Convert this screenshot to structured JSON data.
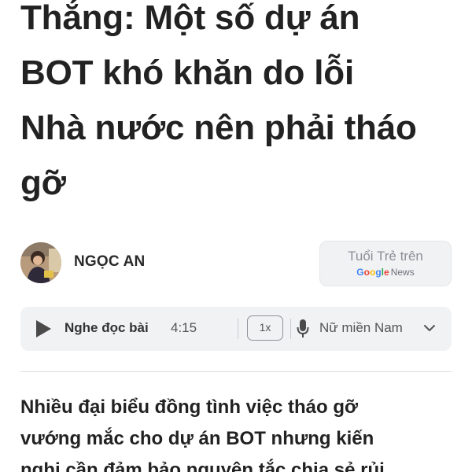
{
  "article": {
    "headline_lines": [
      "Thắng: Một số dự án",
      "BOT khó khăn do lỗi",
      "Nhà nước nên phải tháo",
      "gỡ"
    ],
    "author": "NGỌC AN",
    "source": {
      "text": "Tuổi Trẻ trên",
      "google": [
        "G",
        "o",
        "o",
        "g",
        "l",
        "e"
      ],
      "news": "News"
    },
    "lead_lines": [
      "Nhiều đại biểu đồng tình việc tháo gỡ",
      "vướng mắc cho dự án BOT nhưng kiến",
      "nghị cần đảm bảo nguyên tắc chia sẻ rủi"
    ]
  },
  "player": {
    "play_icon": "play-icon",
    "label": "Nghe đọc bài",
    "duration": "4:15",
    "speed": "1x",
    "mic_icon": "microphone-icon",
    "voice": "Nữ miền Nam",
    "dropdown_icon": "chevron-down-icon"
  },
  "colors": {
    "google": [
      "#4285F4",
      "#EA4335",
      "#FBBC05",
      "#4285F4",
      "#34A853",
      "#EA4335"
    ]
  }
}
